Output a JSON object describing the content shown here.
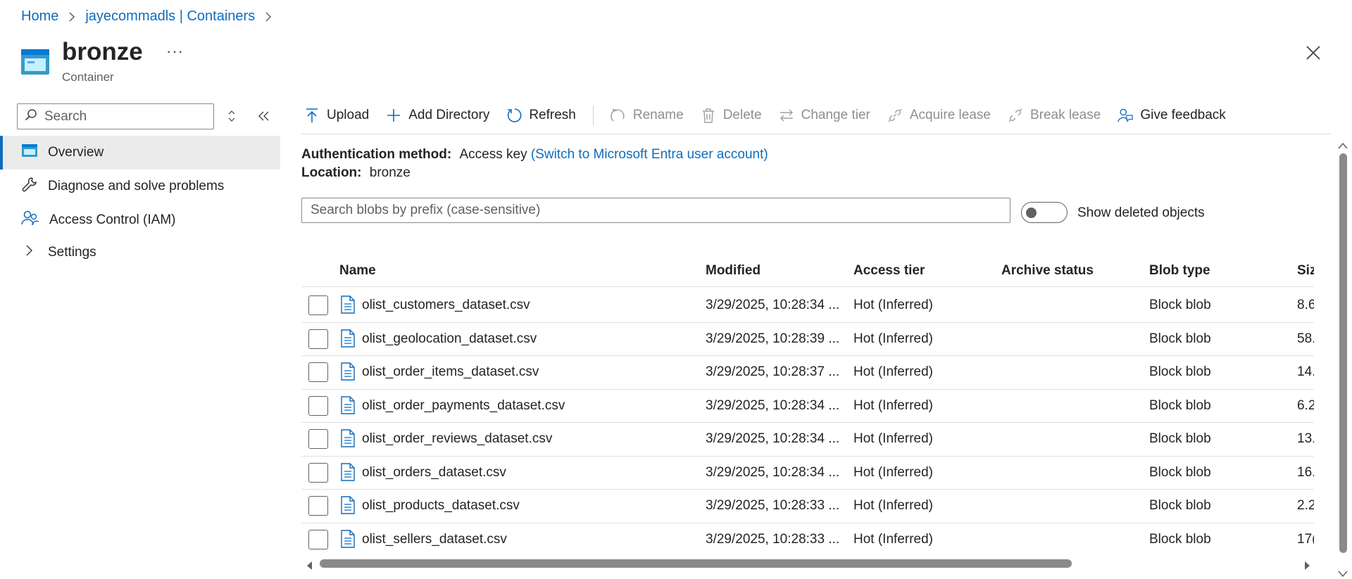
{
  "breadcrumb": {
    "home": "Home",
    "parent": "jayecommadls | Containers"
  },
  "header": {
    "title": "bronze",
    "subtitle": "Container",
    "more": "···"
  },
  "sidebar": {
    "search_placeholder": "Search",
    "items": [
      {
        "label": "Overview",
        "icon": "container-icon",
        "active": true
      },
      {
        "label": "Diagnose and solve problems",
        "icon": "wrench-icon"
      },
      {
        "label": "Access Control (IAM)",
        "icon": "people-icon"
      },
      {
        "label": "Settings",
        "icon": "chevron-right-icon"
      }
    ]
  },
  "toolbar": {
    "upload": "Upload",
    "add_directory": "Add Directory",
    "refresh": "Refresh",
    "rename": "Rename",
    "delete": "Delete",
    "change_tier": "Change tier",
    "acquire_lease": "Acquire lease",
    "break_lease": "Break lease",
    "give_feedback": "Give feedback"
  },
  "info": {
    "auth_label": "Authentication method:",
    "auth_value": "Access key",
    "auth_link": "(Switch to Microsoft Entra user account)",
    "location_label": "Location:",
    "location_value": "bronze"
  },
  "blob_search": {
    "placeholder": "Search blobs by prefix (case-sensitive)"
  },
  "show_deleted": {
    "label": "Show deleted objects",
    "on": false
  },
  "table": {
    "columns": [
      "Name",
      "Modified",
      "Access tier",
      "Archive status",
      "Blob type",
      "Siz"
    ],
    "rows": [
      {
        "name": "olist_customers_dataset.csv",
        "modified": "3/29/2025, 10:28:34 ...",
        "tier": "Hot (Inferred)",
        "archive": "",
        "type": "Block blob",
        "size": "8.6"
      },
      {
        "name": "olist_geolocation_dataset.csv",
        "modified": "3/29/2025, 10:28:39 ...",
        "tier": "Hot (Inferred)",
        "archive": "",
        "type": "Block blob",
        "size": "58."
      },
      {
        "name": "olist_order_items_dataset.csv",
        "modified": "3/29/2025, 10:28:37 ...",
        "tier": "Hot (Inferred)",
        "archive": "",
        "type": "Block blob",
        "size": "14."
      },
      {
        "name": "olist_order_payments_dataset.csv",
        "modified": "3/29/2025, 10:28:34 ...",
        "tier": "Hot (Inferred)",
        "archive": "",
        "type": "Block blob",
        "size": "6.2"
      },
      {
        "name": "olist_order_reviews_dataset.csv",
        "modified": "3/29/2025, 10:28:34 ...",
        "tier": "Hot (Inferred)",
        "archive": "",
        "type": "Block blob",
        "size": "13."
      },
      {
        "name": "olist_orders_dataset.csv",
        "modified": "3/29/2025, 10:28:34 ...",
        "tier": "Hot (Inferred)",
        "archive": "",
        "type": "Block blob",
        "size": "16."
      },
      {
        "name": "olist_products_dataset.csv",
        "modified": "3/29/2025, 10:28:33 ...",
        "tier": "Hot (Inferred)",
        "archive": "",
        "type": "Block blob",
        "size": "2.2"
      },
      {
        "name": "olist_sellers_dataset.csv",
        "modified": "3/29/2025, 10:28:33 ...",
        "tier": "Hot (Inferred)",
        "archive": "",
        "type": "Block blob",
        "size": "17("
      }
    ]
  },
  "colors": {
    "accent": "#0f6cbd",
    "text": "#242424",
    "muted": "#616161",
    "disabled": "#8f8f8f",
    "selected_bg": "#ebebeb"
  }
}
